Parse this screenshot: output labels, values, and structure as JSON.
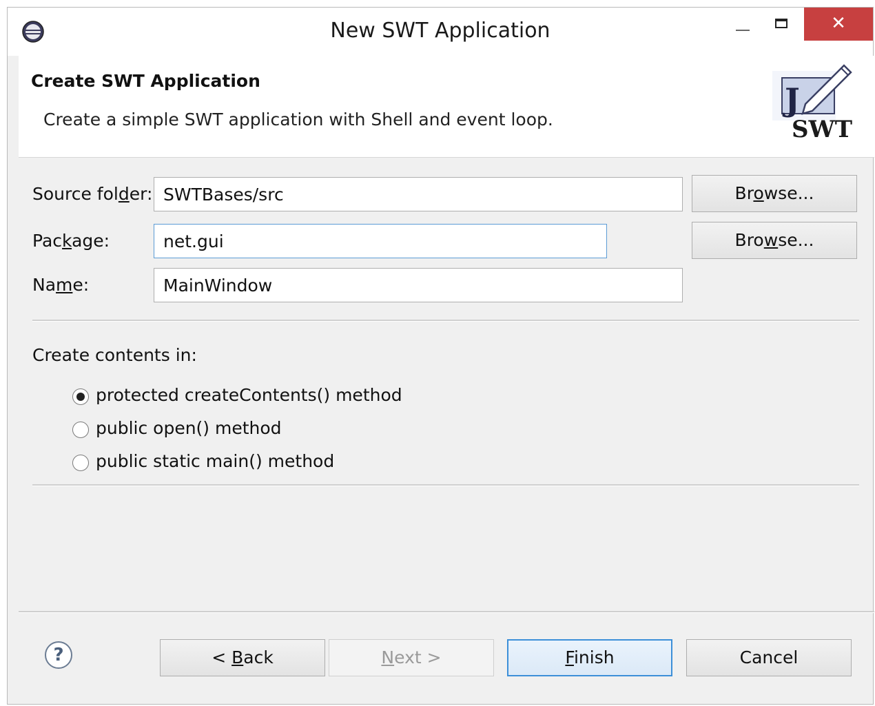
{
  "window": {
    "title": "New SWT Application",
    "close_glyph": "✕"
  },
  "banner": {
    "title": "Create SWT Application",
    "description": "Create a simple SWT application with Shell and event loop.",
    "logo_letter": "J",
    "logo_text": "SWT"
  },
  "form": {
    "source_folder": {
      "label_pre": "Source fol",
      "label_mnemonic": "d",
      "label_post": "er:",
      "value": "SWTBases/src",
      "browse_pre": "Br",
      "browse_mnemonic": "o",
      "browse_post": "wse..."
    },
    "package": {
      "label_pre": "Pac",
      "label_mnemonic": "k",
      "label_post": "age:",
      "value": "net.gui",
      "browse_pre": "Bro",
      "browse_mnemonic": "w",
      "browse_post": "se..."
    },
    "name": {
      "label_pre": "Na",
      "label_mnemonic": "m",
      "label_post": "e:",
      "value": "MainWindow"
    },
    "create_contents_label": "Create contents in:",
    "options": [
      {
        "label": "protected createContents() method",
        "checked": true
      },
      {
        "label": "public open() method",
        "checked": false
      },
      {
        "label": "public static main() method",
        "checked": false
      }
    ]
  },
  "footer": {
    "help_glyph": "?",
    "back": {
      "pre": "< ",
      "mnemonic": "B",
      "post": "ack"
    },
    "next": {
      "mnemonic": "N",
      "post": "ext >"
    },
    "finish": {
      "mnemonic": "F",
      "post": "inish"
    },
    "cancel": "Cancel"
  },
  "colors": {
    "close_button": "#c74040",
    "focus_border": "#5b9bd5",
    "default_button_border": "#3c8fd8"
  },
  "icons": {
    "app": "eclipse-icon",
    "banner": "swt-logo-icon",
    "package_hint": "lightbulb-icon",
    "help": "help-icon"
  }
}
